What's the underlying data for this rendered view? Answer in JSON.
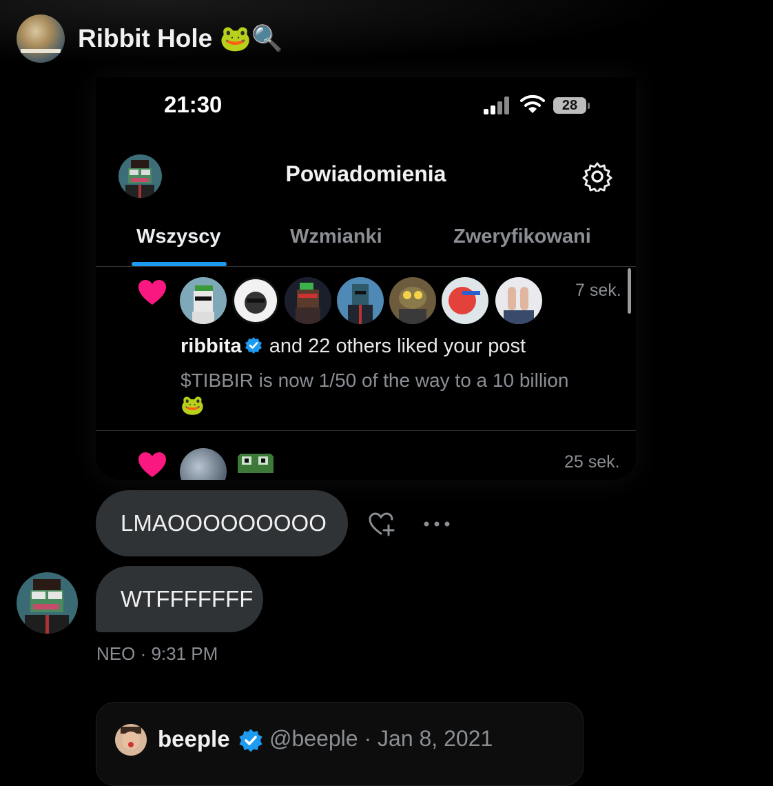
{
  "chat": {
    "group_name": "Ribbit Hole",
    "group_emoji": "🐸🔍"
  },
  "screenshot": {
    "status_bar": {
      "time": "21:30",
      "battery": "28"
    },
    "header": {
      "title": "Powiadomienia"
    },
    "tabs": [
      {
        "label": "Wszyscy",
        "active": true
      },
      {
        "label": "Wzmianki",
        "active": false
      },
      {
        "label": "Zweryfikowani",
        "active": false
      }
    ],
    "notifications": [
      {
        "time": "7 sek.",
        "user": "ribbita",
        "action": "and 22 others liked your post",
        "preview": "$TIBBIR is now 1/50 of the way to a 10 billion",
        "preview_emoji": "🐸"
      },
      {
        "time": "25 sek."
      }
    ]
  },
  "messages": [
    {
      "text": "LMAOOOOOOOOO"
    },
    {
      "text": "WTFFFFFFF"
    }
  ],
  "message_meta": "NEO · 9:31 PM",
  "quoted_post": {
    "name": "beeple",
    "handle_date": "@beeple · Jan 8, 2021"
  },
  "colors": {
    "accent": "#1d9bf0",
    "like": "#f91880",
    "bubble": "#2f3336",
    "muted_text": "#8b8f94"
  },
  "icons": [
    "search-icon",
    "signal-icon",
    "wifi-icon",
    "battery-icon",
    "gear-icon",
    "heart-icon",
    "verified-badge-icon",
    "add-reaction-icon",
    "more-icon"
  ]
}
